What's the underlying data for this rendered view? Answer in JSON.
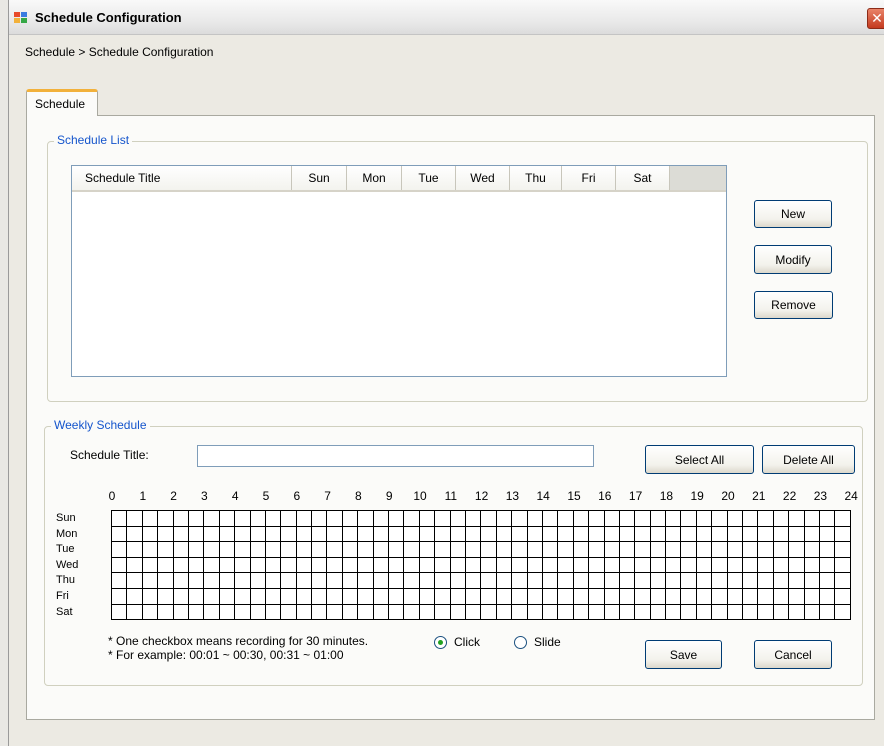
{
  "window": {
    "title": "Schedule Configuration",
    "close_symbol": "✕"
  },
  "breadcrumb": "Schedule > Schedule Configuration",
  "tabs": [
    {
      "label": "Schedule",
      "active": true
    }
  ],
  "schedule_list": {
    "group_title": "Schedule List",
    "columns": [
      "Schedule Title",
      "Sun",
      "Mon",
      "Tue",
      "Wed",
      "Thu",
      "Fri",
      "Sat"
    ],
    "rows": [],
    "buttons": {
      "new": "New",
      "modify": "Modify",
      "remove": "Remove"
    }
  },
  "weekly_schedule": {
    "group_title": "Weekly Schedule",
    "title_label": "Schedule Title:",
    "title_value": "",
    "select_all": "Select All",
    "delete_all": "Delete All",
    "hours": [
      "0",
      "1",
      "2",
      "3",
      "4",
      "5",
      "6",
      "7",
      "8",
      "9",
      "10",
      "11",
      "12",
      "13",
      "14",
      "15",
      "16",
      "17",
      "18",
      "19",
      "20",
      "21",
      "22",
      "23",
      "24"
    ],
    "days": [
      "Sun",
      "Mon",
      "Tue",
      "Wed",
      "Thu",
      "Fri",
      "Sat"
    ],
    "slots_per_day": 48,
    "note_line1": "* One checkbox means recording for 30 minutes.",
    "note_line2": "* For example: 00:01 ~ 00:30, 00:31 ~ 01:00",
    "mode_click": "Click",
    "mode_slide": "Slide",
    "selected_mode": "Click",
    "save": "Save",
    "cancel": "Cancel"
  },
  "colors": {
    "group_title": "#1555cc",
    "tab_accent": "#f2b13b",
    "radio_selected": "#21a121"
  }
}
